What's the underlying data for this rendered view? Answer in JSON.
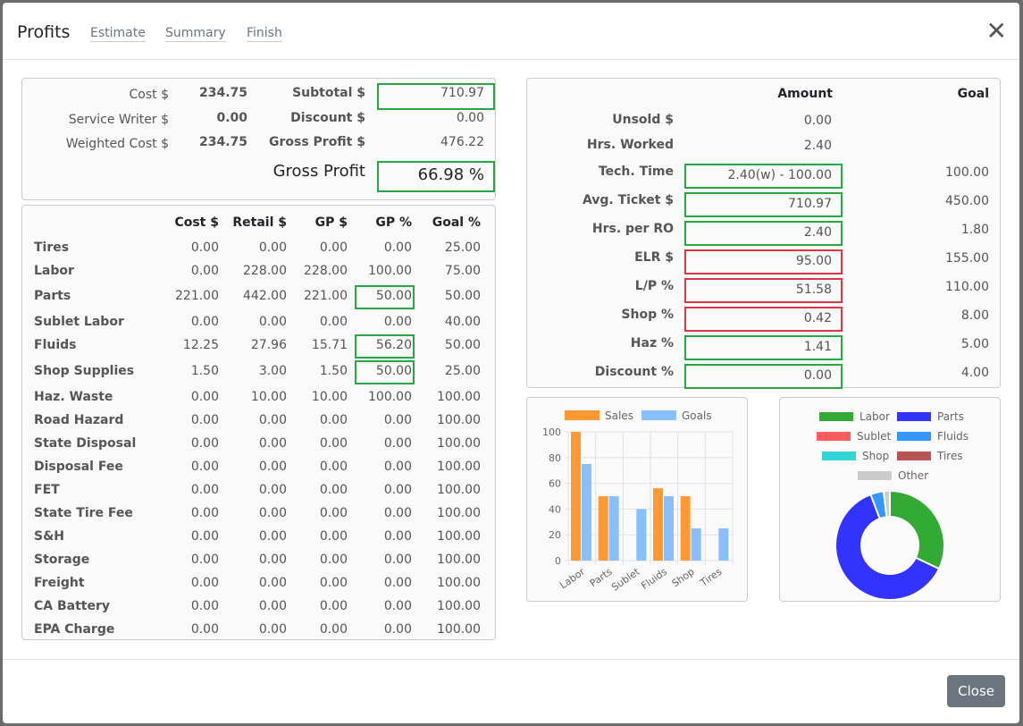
{
  "header": {
    "title": "Profits",
    "tabs": [
      "Estimate",
      "Summary",
      "Finish"
    ]
  },
  "summary": {
    "left": [
      {
        "label": "Cost $",
        "value": "234.75"
      },
      {
        "label": "Service Writer $",
        "value": "0.00"
      },
      {
        "label": "Weighted Cost $",
        "value": "234.75"
      }
    ],
    "right": [
      {
        "label": "Subtotal $",
        "value": "710.97"
      },
      {
        "label": "Discount $",
        "value": "0.00"
      },
      {
        "label": "Gross Profit $",
        "value": "476.22"
      }
    ],
    "gp_label": "Gross Profit",
    "gp_value": "66.98 %"
  },
  "breakdown": {
    "columns": [
      "Cost $",
      "Retail $",
      "GP $",
      "GP %",
      "Goal %"
    ],
    "rows": [
      {
        "name": "Tires",
        "v": [
          "0.00",
          "0.00",
          "0.00",
          "0.00",
          "25.00"
        ]
      },
      {
        "name": "Labor",
        "v": [
          "0.00",
          "228.00",
          "228.00",
          "100.00",
          "75.00"
        ]
      },
      {
        "name": "Parts",
        "v": [
          "221.00",
          "442.00",
          "221.00",
          "50.00",
          "50.00"
        ],
        "boxed": true
      },
      {
        "name": "Sublet Labor",
        "v": [
          "0.00",
          "0.00",
          "0.00",
          "0.00",
          "40.00"
        ]
      },
      {
        "name": "Fluids",
        "v": [
          "12.25",
          "27.96",
          "15.71",
          "56.20",
          "50.00"
        ],
        "boxed": true
      },
      {
        "name": "Shop Supplies",
        "v": [
          "1.50",
          "3.00",
          "1.50",
          "50.00",
          "25.00"
        ],
        "boxed": true
      },
      {
        "name": "Haz. Waste",
        "v": [
          "0.00",
          "10.00",
          "10.00",
          "100.00",
          "100.00"
        ]
      },
      {
        "name": "Road Hazard",
        "v": [
          "0.00",
          "0.00",
          "0.00",
          "0.00",
          "100.00"
        ]
      },
      {
        "name": "State Disposal",
        "v": [
          "0.00",
          "0.00",
          "0.00",
          "0.00",
          "100.00"
        ]
      },
      {
        "name": "Disposal Fee",
        "v": [
          "0.00",
          "0.00",
          "0.00",
          "0.00",
          "100.00"
        ]
      },
      {
        "name": "FET",
        "v": [
          "0.00",
          "0.00",
          "0.00",
          "0.00",
          "100.00"
        ]
      },
      {
        "name": "State Tire Fee",
        "v": [
          "0.00",
          "0.00",
          "0.00",
          "0.00",
          "100.00"
        ]
      },
      {
        "name": "S&H",
        "v": [
          "0.00",
          "0.00",
          "0.00",
          "0.00",
          "100.00"
        ]
      },
      {
        "name": "Storage",
        "v": [
          "0.00",
          "0.00",
          "0.00",
          "0.00",
          "100.00"
        ]
      },
      {
        "name": "Freight",
        "v": [
          "0.00",
          "0.00",
          "0.00",
          "0.00",
          "100.00"
        ]
      },
      {
        "name": "CA Battery",
        "v": [
          "0.00",
          "0.00",
          "0.00",
          "0.00",
          "100.00"
        ]
      },
      {
        "name": "EPA Charge",
        "v": [
          "0.00",
          "0.00",
          "0.00",
          "0.00",
          "100.00"
        ]
      }
    ]
  },
  "metrics": {
    "columns": [
      "Amount",
      "Goal"
    ],
    "rows": [
      {
        "label": "Unsold $",
        "amount": "0.00",
        "goal": ""
      },
      {
        "label": "Hrs. Worked",
        "amount": "2.40",
        "goal": ""
      },
      {
        "label": "Tech. Time",
        "amount": "2.40(w) - 100.00",
        "goal": "100.00",
        "status": "good"
      },
      {
        "label": "Avg. Ticket $",
        "amount": "710.97",
        "goal": "450.00",
        "status": "good"
      },
      {
        "label": "Hrs. per RO",
        "amount": "2.40",
        "goal": "1.80",
        "status": "good"
      },
      {
        "label": "ELR $",
        "amount": "95.00",
        "goal": "155.00",
        "status": "bad"
      },
      {
        "label": "L/P %",
        "amount": "51.58",
        "goal": "110.00",
        "status": "bad"
      },
      {
        "label": "Shop %",
        "amount": "0.42",
        "goal": "8.00",
        "status": "bad"
      },
      {
        "label": "Haz %",
        "amount": "1.41",
        "goal": "5.00",
        "status": "good"
      },
      {
        "label": "Discount %",
        "amount": "0.00",
        "goal": "4.00",
        "status": "good"
      }
    ]
  },
  "colors": {
    "good": "#28a745",
    "bad": "#dc3545"
  },
  "chart_data": [
    {
      "type": "bar",
      "categories": [
        "Labor",
        "Parts",
        "Sublet",
        "Fluids",
        "Shop",
        "Tires"
      ],
      "series": [
        {
          "name": "Sales",
          "color": "#ff9933",
          "values": [
            100,
            50,
            0,
            56.2,
            50,
            0
          ]
        },
        {
          "name": "Goals",
          "color": "#88bfff",
          "values": [
            75,
            50,
            40,
            50,
            25,
            25
          ]
        }
      ],
      "ylim": [
        0,
        100
      ],
      "yticks": [
        "0",
        "20",
        "40",
        "60",
        "80",
        "100"
      ],
      "grid": true,
      "legend": "top"
    },
    {
      "type": "pie",
      "donut": true,
      "legend": "top",
      "labels": [
        "Labor",
        "Parts",
        "Sublet",
        "Fluids",
        "Shop",
        "Tires",
        "Other"
      ],
      "colors": [
        "#33aa33",
        "#3333ff",
        "#ff5c5c",
        "#3399ff",
        "#33d6d6",
        "#b85555",
        "#cccccc"
      ],
      "values": [
        228,
        442,
        0,
        27.96,
        0,
        0,
        13
      ]
    }
  ],
  "footer": {
    "close_label": "Close"
  }
}
